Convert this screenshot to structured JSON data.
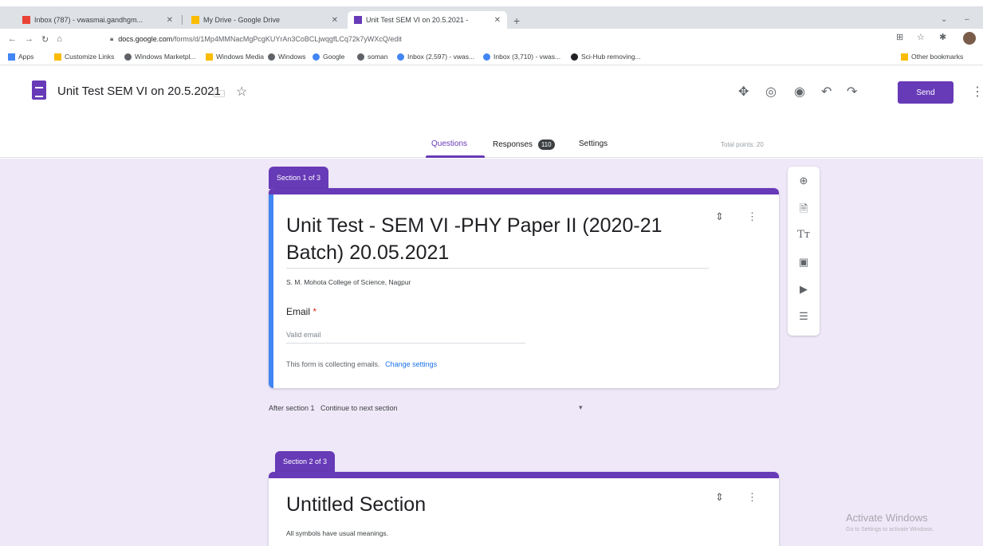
{
  "browser": {
    "tabs": [
      {
        "label": "Inbox (787) - vwasmai.gandhgm...",
        "favicon_color": "#ea4335"
      },
      {
        "label": "My Drive - Google Drive",
        "favicon_color": "#fbbc04"
      },
      {
        "label": "Unit Test SEM VI on 20.5.2021 -",
        "favicon_color": "#673ab7"
      }
    ],
    "url_host": "docs.google.com",
    "url_path": "/forms/d/1Mp4MMNacMgPcgKUYrAn3CoBCLjwqgfLCq72k7yWXcQ/edit",
    "bookmarks": [
      {
        "label": "Apps",
        "color": "#4285f4"
      },
      {
        "label": "Customize Links",
        "color": "#fbbc04"
      },
      {
        "label": "Windows Marketpl...",
        "color": "#5f6368"
      },
      {
        "label": "Windows Media",
        "color": "#fbbc04"
      },
      {
        "label": "Windows",
        "color": "#5f6368"
      },
      {
        "label": "Google",
        "color": "#4285f4"
      },
      {
        "label": "soman",
        "color": "#5f6368"
      },
      {
        "label": "Inbox (2,597) - vwas...",
        "color": "#4285f4"
      },
      {
        "label": "Inbox (3,710) - vwas...",
        "color": "#4285f4"
      },
      {
        "label": "Sci-Hub removing...",
        "color": "#202124"
      },
      {
        "label": "Other bookmarks",
        "color": "#fbbc04"
      }
    ]
  },
  "form": {
    "doc_title": "Unit Test SEM VI on 20.5.2021",
    "send_label": "Send",
    "tabs": {
      "questions": "Questions",
      "responses": "Responses",
      "responses_count": "110",
      "settings": "Settings"
    },
    "total_points": "Total points: 20",
    "section1": {
      "tag": "Section 1 of 3",
      "title_line1": "Unit Test - SEM VI -PHY Paper II  (2020-21",
      "title_line2": "Batch)  20.05.2021",
      "description": "S. M. Mohota College of Science, Nagpur",
      "email_label": "Email",
      "email_required": "*",
      "email_placeholder": "Valid email",
      "collecting_note": "This form is collecting emails.",
      "change_settings": "Change settings"
    },
    "after_section": {
      "label": "After section 1",
      "value": "Continue to next section"
    },
    "section2": {
      "tag": "Section 2 of 3",
      "title": "Untitled Section",
      "description": "All symbols have usual meanings."
    }
  },
  "watermark": {
    "title": "Activate Windows",
    "subtitle": "Go to Settings to activate Windows."
  },
  "colors": {
    "accent": "#673ab7",
    "canvas": "#efe8f8",
    "focus": "#4285f4"
  }
}
